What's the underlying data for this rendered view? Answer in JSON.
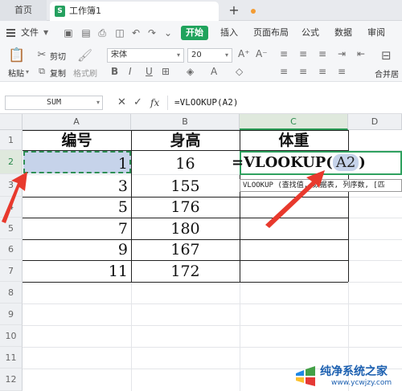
{
  "tabs": {
    "home": "首页",
    "document": "工作簿1",
    "add": "+"
  },
  "menu": {
    "file": "文件",
    "start": "开始",
    "items": [
      "插入",
      "页面布局",
      "公式",
      "数据",
      "审阅"
    ]
  },
  "ribbon": {
    "paste": "粘贴",
    "cut": "剪切",
    "copy": "复制",
    "format_painter": "格式刷",
    "font_name": "宋体",
    "font_size": "20",
    "merge_center": "合并居"
  },
  "formula_bar": {
    "name_box": "SUM",
    "fx": "fx",
    "formula": "=VLOOKUP(A2)"
  },
  "grid": {
    "columns": [
      "A",
      "B",
      "C",
      "D"
    ],
    "rows": [
      "1",
      "2",
      "3",
      "4",
      "5",
      "6",
      "7",
      "8",
      "9",
      "10",
      "11",
      "12"
    ],
    "headers": [
      "编号",
      "身高",
      "体重"
    ],
    "col_a": [
      "1",
      "3",
      "5",
      "7",
      "9",
      "11"
    ],
    "col_b": [
      "16",
      "155",
      "176",
      "180",
      "167",
      "172"
    ],
    "editing_formula_prefix": "=VLOOKUP(",
    "editing_formula_ref": "A2",
    "editing_formula_suffix": ")",
    "tooltip": "VLOOKUP (查找值, 数据表, 列序数, [匹"
  },
  "watermark": {
    "title": "纯净系统之家",
    "url": "www.ycwjzy.com"
  },
  "colors": {
    "accent": "#1fa35c",
    "selection": "#c6d3ea",
    "arrow": "#e8392d"
  }
}
